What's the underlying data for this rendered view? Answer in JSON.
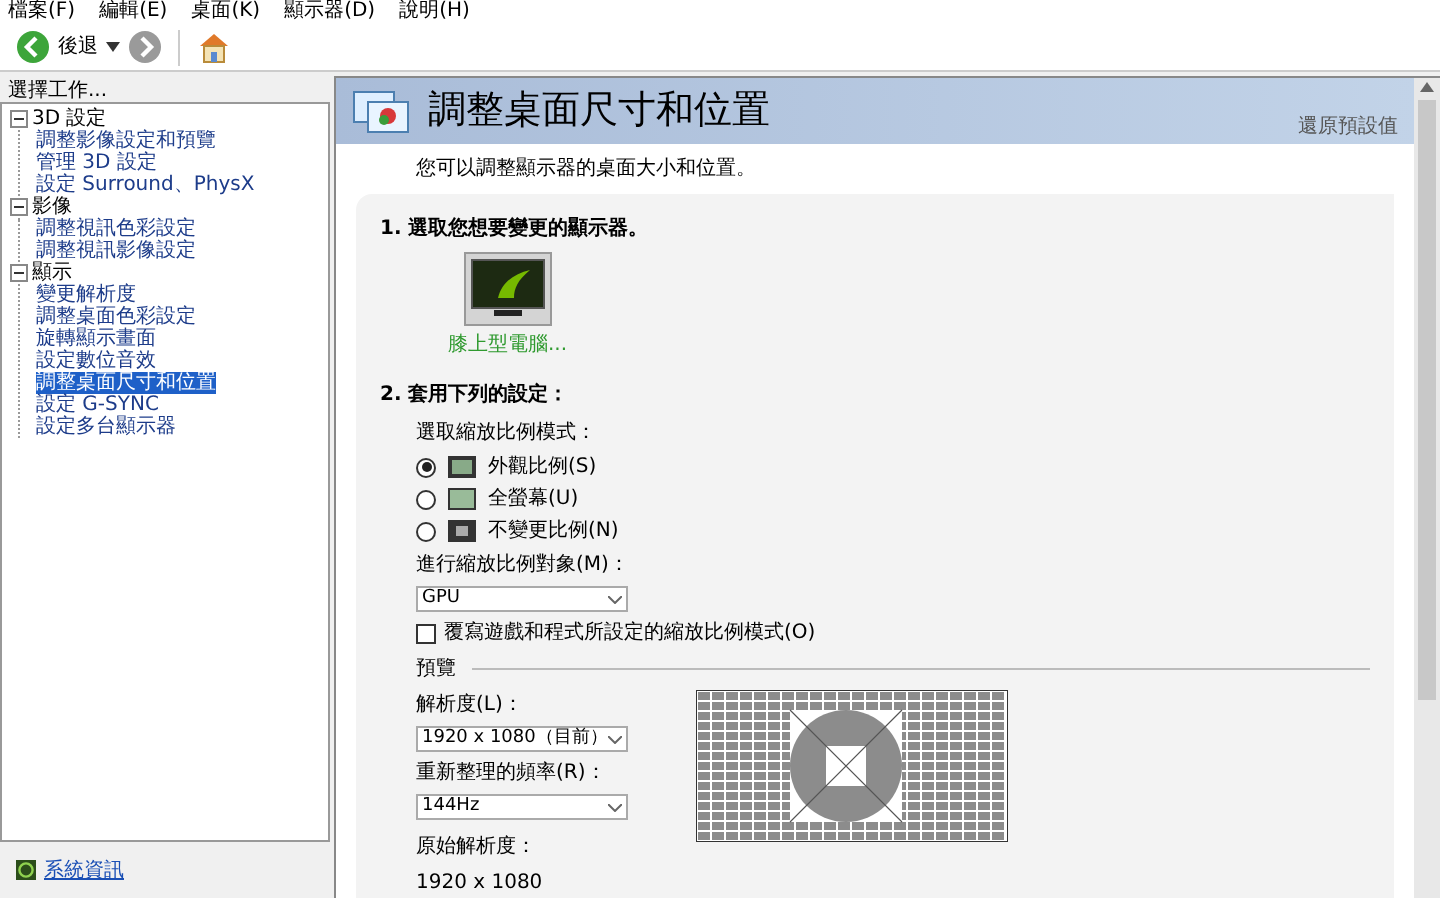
{
  "menu": [
    "檔案(F)",
    "編輯(E)",
    "桌面(K)",
    "顯示器(D)",
    "說明(H)"
  ],
  "toolbar": {
    "back_label": "後退"
  },
  "sidebar": {
    "title": "選擇工作...",
    "tree": [
      {
        "label": "3D 設定",
        "expanded": true,
        "children": [
          {
            "label": "調整影像設定和預覽",
            "selected": false
          },
          {
            "label": "管理 3D 設定",
            "selected": false
          },
          {
            "label": "設定 Surround、PhysX",
            "selected": false
          }
        ]
      },
      {
        "label": "影像",
        "expanded": true,
        "children": [
          {
            "label": "調整視訊色彩設定",
            "selected": false
          },
          {
            "label": "調整視訊影像設定",
            "selected": false
          }
        ]
      },
      {
        "label": "顯示",
        "expanded": true,
        "children": [
          {
            "label": "變更解析度",
            "selected": false
          },
          {
            "label": "調整桌面色彩設定",
            "selected": false
          },
          {
            "label": "旋轉顯示畫面",
            "selected": false
          },
          {
            "label": "設定數位音效",
            "selected": false
          },
          {
            "label": "調整桌面尺寸和位置",
            "selected": true
          },
          {
            "label": "設定 G-SYNC",
            "selected": false
          },
          {
            "label": "設定多台顯示器",
            "selected": false
          }
        ]
      }
    ],
    "footer_link": "系統資訊"
  },
  "page": {
    "title": "調整桌面尺寸和位置",
    "restore_link": "還原預設值",
    "description": "您可以調整顯示器的桌面大小和位置。",
    "step1": {
      "heading": "1. 選取您想要變更的顯示器。",
      "displays": [
        {
          "label": "膝上型電腦...",
          "selected": true
        }
      ]
    },
    "step2": {
      "heading": "2. 套用下列的設定：",
      "scaling_label": "選取縮放比例模式：",
      "scaling_modes": [
        {
          "label": "外觀比例(S)",
          "selected": true
        },
        {
          "label": "全螢幕(U)",
          "selected": false
        },
        {
          "label": "不變更比例(N)",
          "selected": false
        }
      ],
      "perform_label": "進行縮放比例對象(M)：",
      "perform_value": "GPU",
      "override": {
        "label": "覆寫遊戲和程式所設定的縮放比例模式(O)",
        "checked": false
      },
      "preview_label": "預覽",
      "resolution_label": "解析度(L)：",
      "resolution_value": "1920 x 1080（目前）",
      "refresh_label": "重新整理的頻率(R)：",
      "refresh_value": "144Hz",
      "native_label": "原始解析度：",
      "native_value": "1920 x 1080"
    }
  }
}
